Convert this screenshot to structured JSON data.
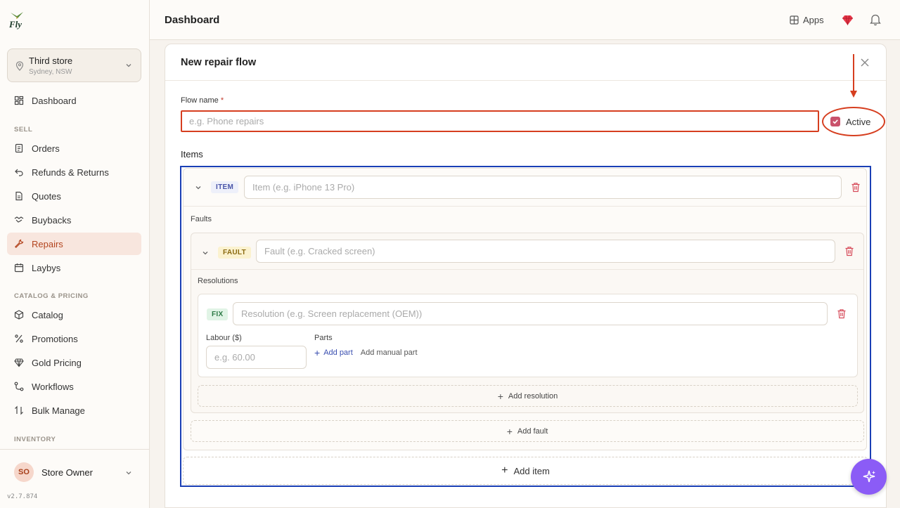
{
  "app": {
    "logo_text": "Fly",
    "version": "v2.7.874"
  },
  "store": {
    "name": "Third store",
    "location": "Sydney, NSW"
  },
  "nav": {
    "dashboard": "Dashboard",
    "sections": {
      "sell": "SELL",
      "catalog": "CATALOG & PRICING",
      "inventory": "INVENTORY"
    },
    "sell_items": [
      "Orders",
      "Refunds & Returns",
      "Quotes",
      "Buybacks",
      "Repairs",
      "Laybys"
    ],
    "catalog_items": [
      "Catalog",
      "Promotions",
      "Gold Pricing",
      "Workflows",
      "Bulk Manage"
    ],
    "active": "Repairs"
  },
  "user": {
    "initials": "SO",
    "name": "Store Owner"
  },
  "topbar": {
    "title": "Dashboard",
    "apps_label": "Apps"
  },
  "form": {
    "title": "New repair flow",
    "flow_name_label": "Flow name",
    "required_marker": "*",
    "flow_name_placeholder": "e.g. Phone repairs",
    "active_label": "Active",
    "active_checked": true,
    "items_label": "Items",
    "item_tag": "ITEM",
    "item_placeholder": "Item (e.g. iPhone 13 Pro)",
    "faults_label": "Faults",
    "fault_tag": "FAULT",
    "fault_placeholder": "Fault (e.g. Cracked screen)",
    "resolutions_label": "Resolutions",
    "fix_tag": "FIX",
    "resolution_placeholder": "Resolution (e.g. Screen replacement (OEM))",
    "labour_label": "Labour ($)",
    "labour_placeholder": "e.g. 60.00",
    "parts_label": "Parts",
    "add_part": "Add part",
    "add_manual_part": "Add manual part",
    "add_resolution": "Add resolution",
    "add_fault": "Add fault",
    "add_item": "Add item"
  },
  "colors": {
    "accent": "#b3451f",
    "annotation_red": "#d63e1f",
    "annotation_blue": "#1a3fb5",
    "fab": "#8b5cf6"
  }
}
